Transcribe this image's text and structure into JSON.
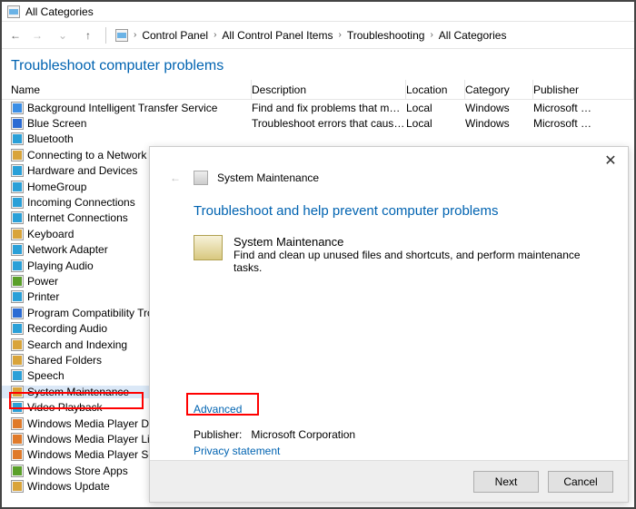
{
  "window_title": "All Categories",
  "breadcrumb": [
    "Control Panel",
    "All Control Panel Items",
    "Troubleshooting",
    "All Categories"
  ],
  "page_heading": "Troubleshoot computer problems",
  "columns": {
    "name": "Name",
    "description": "Description",
    "location": "Location",
    "category": "Category",
    "publisher": "Publisher"
  },
  "rows": [
    {
      "name": "Background Intelligent Transfer Service",
      "desc": "Find and fix problems that may p…",
      "loc": "Local",
      "cat": "Windows",
      "pub": "Microsoft …",
      "color": "#3a8ee6"
    },
    {
      "name": "Blue Screen",
      "desc": "Troubleshoot errors that cause Wi…",
      "loc": "Local",
      "cat": "Windows",
      "pub": "Microsoft …",
      "color": "#2b6cd4"
    },
    {
      "name": "Bluetooth",
      "desc": "",
      "loc": "",
      "cat": "",
      "pub": "",
      "color": "#2aa0d8"
    },
    {
      "name": "Connecting to a Network",
      "desc": "",
      "loc": "",
      "cat": "",
      "pub": "",
      "color": "#d9a43a"
    },
    {
      "name": "Hardware and Devices",
      "desc": "",
      "loc": "",
      "cat": "",
      "pub": "",
      "color": "#2aa0d8"
    },
    {
      "name": "HomeGroup",
      "desc": "",
      "loc": "",
      "cat": "",
      "pub": "",
      "color": "#2aa0d8"
    },
    {
      "name": "Incoming Connections",
      "desc": "",
      "loc": "",
      "cat": "",
      "pub": "",
      "color": "#2aa0d8"
    },
    {
      "name": "Internet Connections",
      "desc": "",
      "loc": "",
      "cat": "",
      "pub": "",
      "color": "#2aa0d8"
    },
    {
      "name": "Keyboard",
      "desc": "",
      "loc": "",
      "cat": "",
      "pub": "",
      "color": "#d9a43a"
    },
    {
      "name": "Network Adapter",
      "desc": "",
      "loc": "",
      "cat": "",
      "pub": "",
      "color": "#2aa0d8"
    },
    {
      "name": "Playing Audio",
      "desc": "",
      "loc": "",
      "cat": "",
      "pub": "",
      "color": "#2aa0d8"
    },
    {
      "name": "Power",
      "desc": "",
      "loc": "",
      "cat": "",
      "pub": "",
      "color": "#5aa02a"
    },
    {
      "name": "Printer",
      "desc": "",
      "loc": "",
      "cat": "",
      "pub": "",
      "color": "#2aa0d8"
    },
    {
      "name": "Program Compatibility Troubleshooter",
      "desc": "",
      "loc": "",
      "cat": "",
      "pub": "",
      "color": "#2b6cd4"
    },
    {
      "name": "Recording Audio",
      "desc": "",
      "loc": "",
      "cat": "",
      "pub": "",
      "color": "#2aa0d8"
    },
    {
      "name": "Search and Indexing",
      "desc": "",
      "loc": "",
      "cat": "",
      "pub": "",
      "color": "#d9a43a"
    },
    {
      "name": "Shared Folders",
      "desc": "",
      "loc": "",
      "cat": "",
      "pub": "",
      "color": "#d9a43a"
    },
    {
      "name": "Speech",
      "desc": "",
      "loc": "",
      "cat": "",
      "pub": "",
      "color": "#2aa0d8"
    },
    {
      "name": "System Maintenance",
      "desc": "",
      "loc": "",
      "cat": "",
      "pub": "",
      "color": "#d9a43a",
      "selected": true
    },
    {
      "name": "Video Playback",
      "desc": "",
      "loc": "",
      "cat": "",
      "pub": "",
      "color": "#2aa0d8"
    },
    {
      "name": "Windows Media Player DVD",
      "desc": "",
      "loc": "",
      "cat": "",
      "pub": "",
      "color": "#e07a2a"
    },
    {
      "name": "Windows Media Player Library",
      "desc": "",
      "loc": "",
      "cat": "",
      "pub": "",
      "color": "#e07a2a"
    },
    {
      "name": "Windows Media Player Settings",
      "desc": "",
      "loc": "",
      "cat": "",
      "pub": "",
      "color": "#e07a2a"
    },
    {
      "name": "Windows Store Apps",
      "desc": "",
      "loc": "",
      "cat": "",
      "pub": "",
      "color": "#5aa02a"
    },
    {
      "name": "Windows Update",
      "desc": "",
      "loc": "",
      "cat": "",
      "pub": "",
      "color": "#d9a43a"
    }
  ],
  "dialog": {
    "label": "System Maintenance",
    "heading": "Troubleshoot and help prevent computer problems",
    "item_title": "System Maintenance",
    "item_desc": "Find and clean up unused files and shortcuts, and perform maintenance tasks.",
    "advanced": "Advanced",
    "publisher_label": "Publisher:",
    "publisher_value": "Microsoft Corporation",
    "privacy": "Privacy statement",
    "next": "Next",
    "cancel": "Cancel"
  }
}
